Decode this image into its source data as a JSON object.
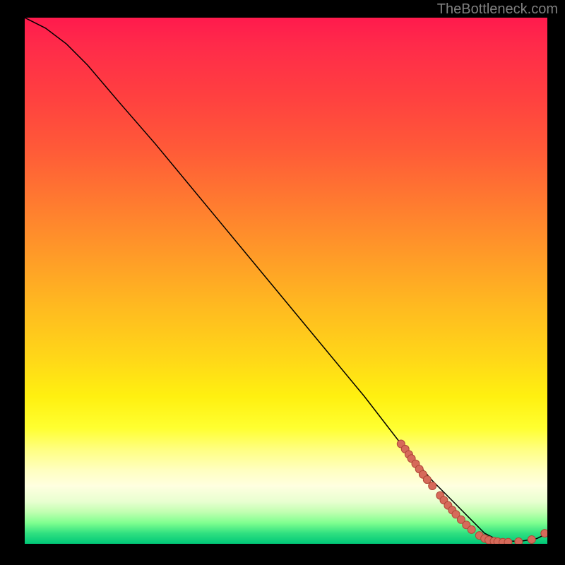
{
  "watermark": "TheBottleneck.com",
  "chart_data": {
    "type": "line",
    "title": "",
    "xlabel": "",
    "ylabel": "",
    "xlim": [
      0,
      100
    ],
    "ylim": [
      0,
      100
    ],
    "curve": {
      "x": [
        0,
        4,
        8,
        12,
        18,
        25,
        35,
        45,
        55,
        65,
        72,
        78,
        82,
        85,
        87,
        88,
        90,
        92,
        95,
        98,
        100
      ],
      "y": [
        100,
        98,
        95,
        91,
        84,
        76,
        64,
        52,
        40,
        28,
        19,
        12,
        8,
        5,
        3,
        2,
        1,
        0.5,
        0.5,
        1,
        2
      ]
    },
    "points": [
      {
        "x": 72.0,
        "y": 19.0
      },
      {
        "x": 72.8,
        "y": 18.0
      },
      {
        "x": 73.5,
        "y": 17.0
      },
      {
        "x": 74.0,
        "y": 16.2
      },
      {
        "x": 74.8,
        "y": 15.2
      },
      {
        "x": 75.5,
        "y": 14.2
      },
      {
        "x": 76.2,
        "y": 13.2
      },
      {
        "x": 77.0,
        "y": 12.2
      },
      {
        "x": 78.0,
        "y": 11.0
      },
      {
        "x": 79.5,
        "y": 9.2
      },
      {
        "x": 80.2,
        "y": 8.3
      },
      {
        "x": 81.0,
        "y": 7.3
      },
      {
        "x": 81.8,
        "y": 6.4
      },
      {
        "x": 82.5,
        "y": 5.6
      },
      {
        "x": 83.5,
        "y": 4.6
      },
      {
        "x": 84.5,
        "y": 3.6
      },
      {
        "x": 85.5,
        "y": 2.7
      },
      {
        "x": 87.0,
        "y": 1.6
      },
      {
        "x": 88.0,
        "y": 1.0
      },
      {
        "x": 88.8,
        "y": 0.7
      },
      {
        "x": 89.8,
        "y": 0.5
      },
      {
        "x": 90.5,
        "y": 0.4
      },
      {
        "x": 91.5,
        "y": 0.3
      },
      {
        "x": 92.5,
        "y": 0.3
      },
      {
        "x": 94.5,
        "y": 0.4
      },
      {
        "x": 97.0,
        "y": 0.8
      },
      {
        "x": 99.5,
        "y": 2.0
      }
    ]
  }
}
